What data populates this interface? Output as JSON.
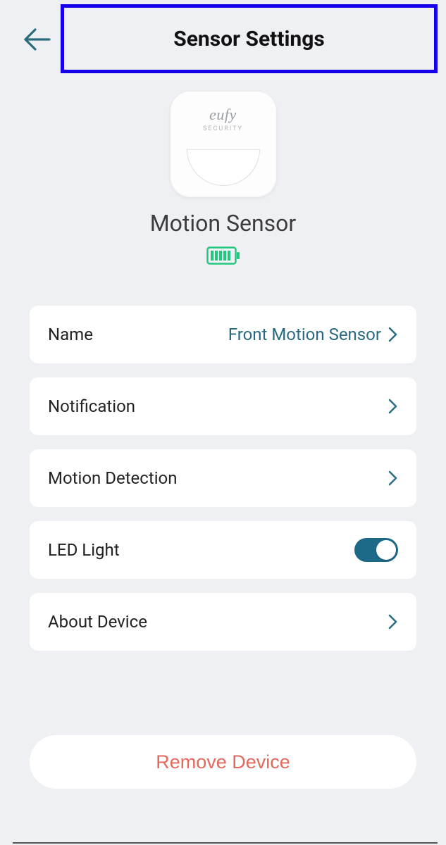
{
  "header": {
    "title": "Sensor Settings"
  },
  "device": {
    "brand": "eufy",
    "brand_sub": "SECURITY",
    "name": "Motion Sensor"
  },
  "rows": {
    "name_label": "Name",
    "name_value": "Front Motion Sensor",
    "notification_label": "Notification",
    "motion_label": "Motion Detection",
    "led_label": "LED Light",
    "about_label": "About Device"
  },
  "led_on": true,
  "remove_label": "Remove Device"
}
